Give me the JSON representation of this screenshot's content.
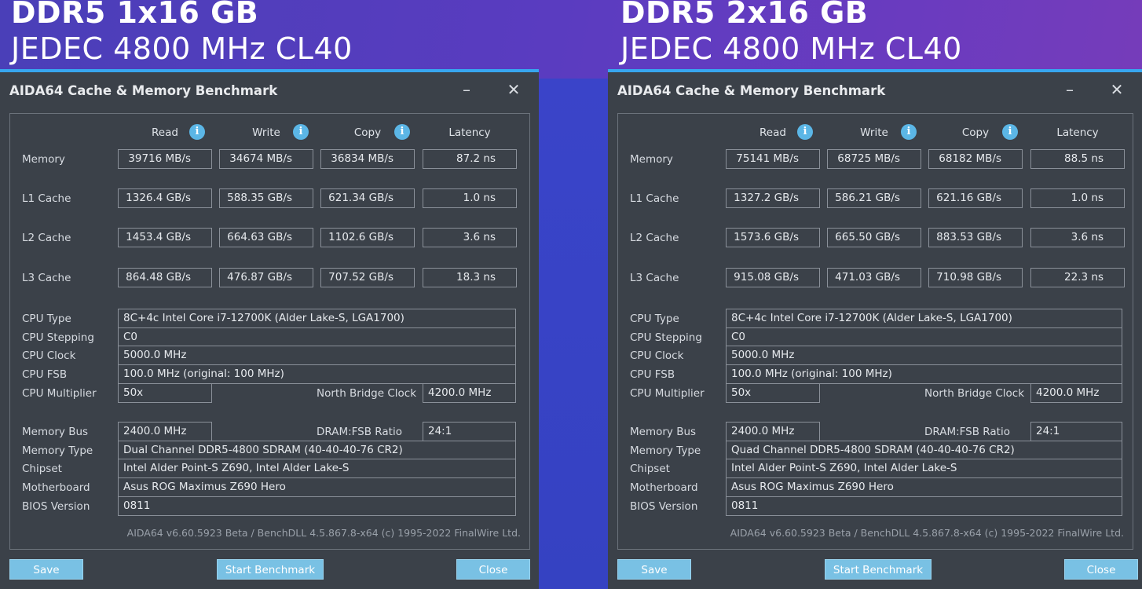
{
  "panels": [
    {
      "headline": "DDR5 1x16 GB",
      "subheadline": "JEDEC 4800 MHz CL40",
      "window": {
        "title": "AIDA64 Cache & Memory Benchmark",
        "minimize": "–",
        "close": "✕"
      },
      "columns": {
        "read": "Read",
        "write": "Write",
        "copy": "Copy",
        "latency": "Latency"
      },
      "bench": {
        "memory": {
          "label": "Memory",
          "read": "39716 MB/s",
          "write": "34674 MB/s",
          "copy": "36834 MB/s",
          "latency": "87.2 ns"
        },
        "l1": {
          "label": "L1 Cache",
          "read": "1326.4 GB/s",
          "write": "588.35 GB/s",
          "copy": "621.34 GB/s",
          "latency": "1.0 ns"
        },
        "l2": {
          "label": "L2 Cache",
          "read": "1453.4 GB/s",
          "write": "664.63 GB/s",
          "copy": "1102.6 GB/s",
          "latency": "3.6 ns"
        },
        "l3": {
          "label": "L3 Cache",
          "read": "864.48 GB/s",
          "write": "476.87 GB/s",
          "copy": "707.52 GB/s",
          "latency": "18.3 ns"
        }
      },
      "info": {
        "cpu_type_label": "CPU Type",
        "cpu_type": "8C+4c Intel Core i7-12700K  (Alder Lake-S, LGA1700)",
        "cpu_stepping_label": "CPU Stepping",
        "cpu_stepping": "C0",
        "cpu_clock_label": "CPU Clock",
        "cpu_clock": "5000.0 MHz",
        "cpu_fsb_label": "CPU FSB",
        "cpu_fsb": "100.0 MHz  (original: 100 MHz)",
        "cpu_multiplier_label": "CPU Multiplier",
        "cpu_multiplier": "50x",
        "nb_clock_label": "North Bridge Clock",
        "nb_clock": "4200.0 MHz",
        "memory_bus_label": "Memory Bus",
        "memory_bus": "2400.0 MHz",
        "dram_fsb_label": "DRAM:FSB Ratio",
        "dram_fsb": "24:1",
        "memory_type_label": "Memory Type",
        "memory_type": "Dual Channel DDR5-4800 SDRAM  (40-40-40-76 CR2)",
        "chipset_label": "Chipset",
        "chipset": "Intel Alder Point-S Z690, Intel Alder Lake-S",
        "motherboard_label": "Motherboard",
        "motherboard": "Asus ROG Maximus Z690 Hero",
        "bios_label": "BIOS Version",
        "bios": "0811"
      },
      "footer": "AIDA64 v6.60.5923 Beta / BenchDLL 4.5.867.8-x64  (c) 1995-2022 FinalWire Ltd.",
      "buttons": {
        "save": "Save",
        "start": "Start Benchmark",
        "close": "Close"
      }
    },
    {
      "headline": "DDR5 2x16 GB",
      "subheadline": "JEDEC 4800 MHz CL40",
      "window": {
        "title": "AIDA64 Cache & Memory Benchmark",
        "minimize": "–",
        "close": "✕"
      },
      "columns": {
        "read": "Read",
        "write": "Write",
        "copy": "Copy",
        "latency": "Latency"
      },
      "bench": {
        "memory": {
          "label": "Memory",
          "read": "75141 MB/s",
          "write": "68725 MB/s",
          "copy": "68182 MB/s",
          "latency": "88.5 ns"
        },
        "l1": {
          "label": "L1 Cache",
          "read": "1327.2 GB/s",
          "write": "586.21 GB/s",
          "copy": "621.16 GB/s",
          "latency": "1.0 ns"
        },
        "l2": {
          "label": "L2 Cache",
          "read": "1573.6 GB/s",
          "write": "665.50 GB/s",
          "copy": "883.53 GB/s",
          "latency": "3.6 ns"
        },
        "l3": {
          "label": "L3 Cache",
          "read": "915.08 GB/s",
          "write": "471.03 GB/s",
          "copy": "710.98 GB/s",
          "latency": "22.3 ns"
        }
      },
      "info": {
        "cpu_type_label": "CPU Type",
        "cpu_type": "8C+4c Intel Core i7-12700K  (Alder Lake-S, LGA1700)",
        "cpu_stepping_label": "CPU Stepping",
        "cpu_stepping": "C0",
        "cpu_clock_label": "CPU Clock",
        "cpu_clock": "5000.0 MHz",
        "cpu_fsb_label": "CPU FSB",
        "cpu_fsb": "100.0 MHz  (original: 100 MHz)",
        "cpu_multiplier_label": "CPU Multiplier",
        "cpu_multiplier": "50x",
        "nb_clock_label": "North Bridge Clock",
        "nb_clock": "4200.0 MHz",
        "memory_bus_label": "Memory Bus",
        "memory_bus": "2400.0 MHz",
        "dram_fsb_label": "DRAM:FSB Ratio",
        "dram_fsb": "24:1",
        "memory_type_label": "Memory Type",
        "memory_type": "Quad Channel DDR5-4800 SDRAM  (40-40-40-76 CR2)",
        "chipset_label": "Chipset",
        "chipset": "Intel Alder Point-S Z690, Intel Alder Lake-S",
        "motherboard_label": "Motherboard",
        "motherboard": "Asus ROG Maximus Z690 Hero",
        "bios_label": "BIOS Version",
        "bios": "0811"
      },
      "footer": "AIDA64 v6.60.5923 Beta / BenchDLL 4.5.867.8-x64  (c) 1995-2022 FinalWire Ltd.",
      "buttons": {
        "save": "Save",
        "start": "Start Benchmark",
        "close": "Close"
      }
    }
  ]
}
